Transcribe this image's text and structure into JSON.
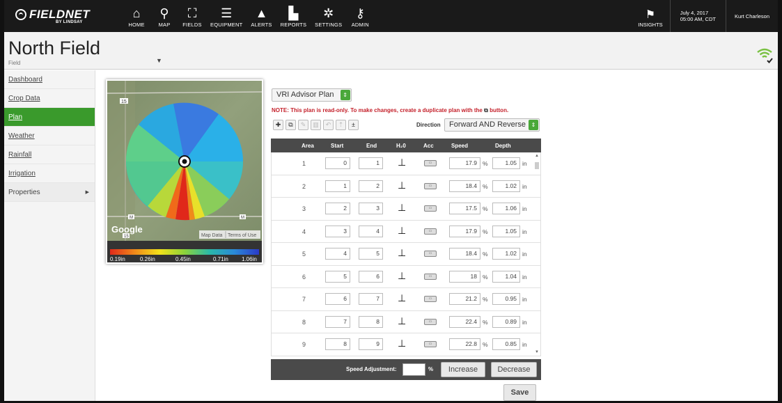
{
  "brand": {
    "name": "FIELDNET",
    "sub": "BY LINDSAY"
  },
  "nav": [
    {
      "label": "HOME",
      "icon": "⌂"
    },
    {
      "label": "MAP",
      "icon": "⚲"
    },
    {
      "label": "FIELDS",
      "icon": "⛶"
    },
    {
      "label": "EQUIPMENT",
      "icon": "☰"
    },
    {
      "label": "ALERTS",
      "icon": "▲"
    },
    {
      "label": "REPORTS",
      "icon": "▙"
    },
    {
      "label": "SETTINGS",
      "icon": "✲"
    },
    {
      "label": "ADMIN",
      "icon": "⚷"
    }
  ],
  "insights": {
    "label": "INSIGHTS",
    "icon": "⚑"
  },
  "datetime": {
    "date": "July 4, 2017",
    "time": "05:00 AM, CDT"
  },
  "user": "Kurt Charleson",
  "header": {
    "title": "North Field",
    "subtitle": "Field"
  },
  "sidebar": [
    {
      "label": "Dashboard"
    },
    {
      "label": "Crop Data"
    },
    {
      "label": "Plan",
      "active": true
    },
    {
      "label": "Weather"
    },
    {
      "label": "Rainfall"
    },
    {
      "label": "Irrigation"
    },
    {
      "label": "Properties"
    }
  ],
  "map": {
    "road_label": "15",
    "road_label_2": "15",
    "marker_m": "M",
    "google": "Google",
    "map_data": "Map Data",
    "terms": "Terms of Use",
    "legend": [
      "0.19in",
      "0.26in",
      "0.45in",
      "0.71in",
      "1.06in"
    ]
  },
  "plan": {
    "select_label": "VRI Advisor Plan",
    "note": "NOTE: This plan is read-only. To make changes, create a duplicate plan with the",
    "note_tail": "button.",
    "direction_label": "Direction",
    "direction_value": "Forward AND Reverse"
  },
  "table": {
    "headers": {
      "area": "Area",
      "start": "Start",
      "end": "End",
      "h2o": "H₂0",
      "acc": "Acc",
      "speed": "Speed",
      "depth": "Depth"
    },
    "speed_unit": "%",
    "depth_unit": "in",
    "rows": [
      {
        "area": "1",
        "start": "0",
        "end": "1",
        "speed": "17.9",
        "depth": "1.05"
      },
      {
        "area": "2",
        "start": "1",
        "end": "2",
        "speed": "18.4",
        "depth": "1.02"
      },
      {
        "area": "3",
        "start": "2",
        "end": "3",
        "speed": "17.5",
        "depth": "1.06"
      },
      {
        "area": "4",
        "start": "3",
        "end": "4",
        "speed": "17.9",
        "depth": "1.05"
      },
      {
        "area": "5",
        "start": "4",
        "end": "5",
        "speed": "18.4",
        "depth": "1.02"
      },
      {
        "area": "6",
        "start": "5",
        "end": "6",
        "speed": "18",
        "depth": "1.04"
      },
      {
        "area": "7",
        "start": "6",
        "end": "7",
        "speed": "21.2",
        "depth": "0.95"
      },
      {
        "area": "8",
        "start": "7",
        "end": "8",
        "speed": "22.4",
        "depth": "0.89"
      },
      {
        "area": "9",
        "start": "8",
        "end": "9",
        "speed": "22.8",
        "depth": "0.85"
      }
    ]
  },
  "footer": {
    "speed_adjustment_label": "Speed Adjustment:",
    "pct": "%",
    "increase": "Increase",
    "decrease": "Decrease",
    "save": "Save"
  },
  "colors": {
    "accent_green": "#3a9a2c",
    "note_red": "#c4202a",
    "nav_bg": "#1a1a1a"
  }
}
